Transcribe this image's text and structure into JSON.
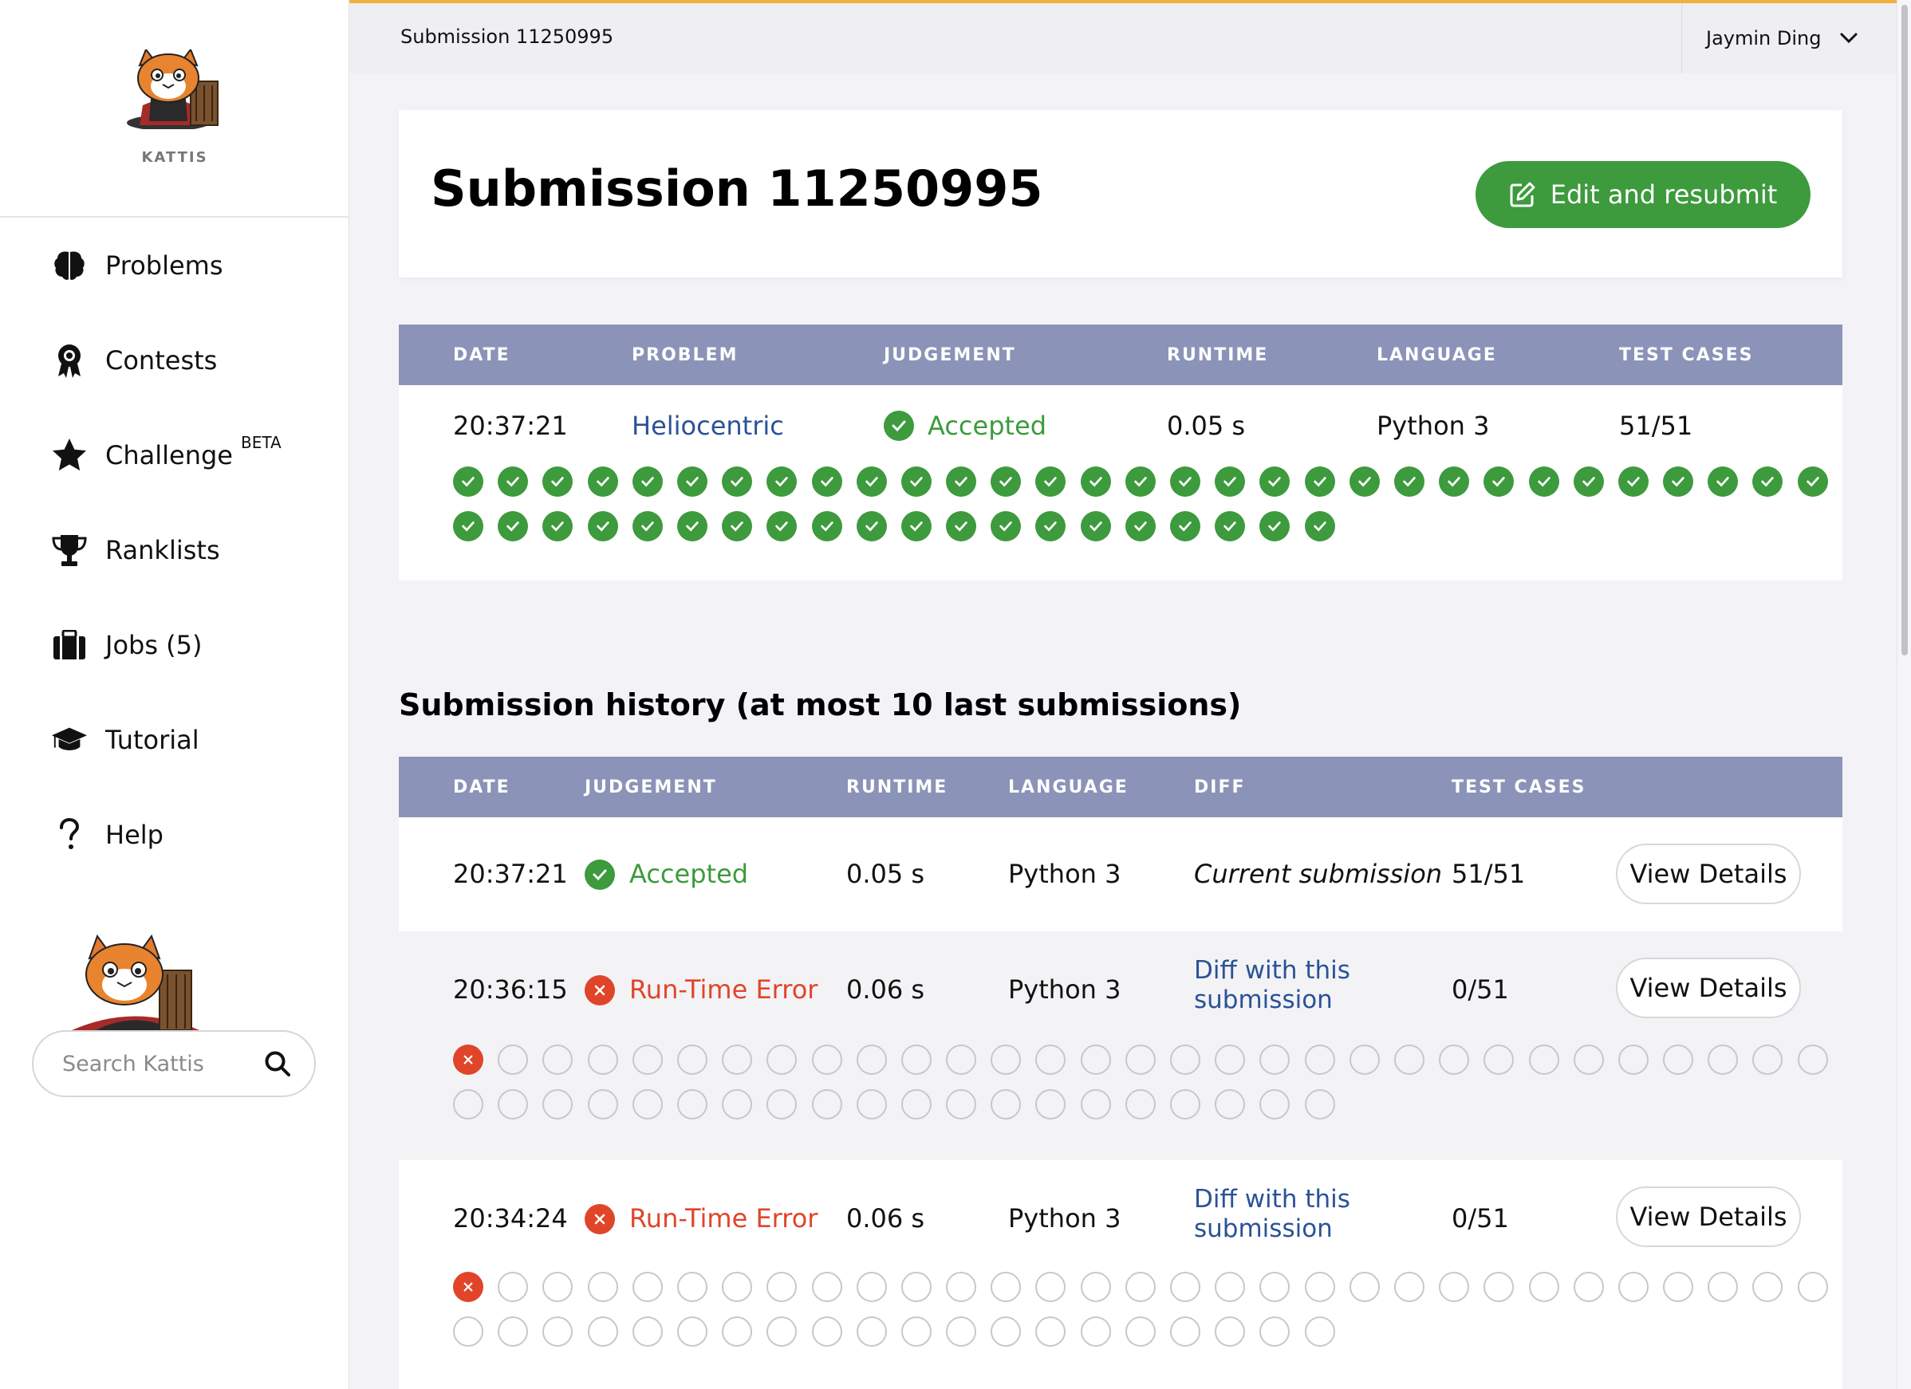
{
  "sidebar": {
    "brand": "KATTIS",
    "nav": [
      {
        "label": "Problems",
        "icon": "brain-icon"
      },
      {
        "label": "Contests",
        "icon": "award-icon"
      },
      {
        "label": "Challenge",
        "icon": "star-icon",
        "badge": "BETA"
      },
      {
        "label": "Ranklists",
        "icon": "trophy-icon"
      },
      {
        "label": "Jobs (5)",
        "icon": "briefcase-icon"
      },
      {
        "label": "Tutorial",
        "icon": "graduation-cap-icon"
      },
      {
        "label": "Help",
        "icon": "question-icon"
      }
    ],
    "search_placeholder": "Search Kattis"
  },
  "topbar": {
    "breadcrumb": "Submission 11250995",
    "user_name": "Jaymin Ding"
  },
  "title_card": {
    "title": "Submission 11250995",
    "resubmit_label": "Edit and resubmit"
  },
  "submission_table": {
    "headers": [
      "DATE",
      "PROBLEM",
      "JUDGEMENT",
      "RUNTIME",
      "LANGUAGE",
      "TEST CASES"
    ],
    "row": {
      "date": "20:37:21",
      "problem": "Heliocentric",
      "judgement": "Accepted",
      "runtime": "0.05 s",
      "language": "Python 3",
      "test_cases": "51/51",
      "tests_passed": 51,
      "tests_total": 51
    }
  },
  "history": {
    "title": "Submission history (at most 10 last submissions)",
    "headers": [
      "DATE",
      "JUDGEMENT",
      "RUNTIME",
      "LANGUAGE",
      "DIFF",
      "TEST CASES"
    ],
    "view_details_label": "View Details",
    "rows": [
      {
        "date": "20:37:21",
        "judgement": "Accepted",
        "status": "accepted",
        "runtime": "0.05 s",
        "language": "Python 3",
        "diff": "Current submission",
        "test_cases": "51/51"
      },
      {
        "date": "20:36:15",
        "judgement": "Run-Time Error",
        "status": "error",
        "runtime": "0.06 s",
        "language": "Python 3",
        "diff_line1": "Diff with this",
        "diff_line2": "submission",
        "test_cases": "0/51",
        "tests_failed_first": 1,
        "tests_total": 51
      },
      {
        "date": "20:34:24",
        "judgement": "Run-Time Error",
        "status": "error",
        "runtime": "0.06 s",
        "language": "Python 3",
        "diff_line1": "Diff with this",
        "diff_line2": "submission",
        "test_cases": "0/51",
        "tests_failed_first": 1,
        "tests_total": 51
      }
    ]
  },
  "colors": {
    "accent_green": "#3d9a3d",
    "error_red": "#e0452a",
    "header_blue": "#8b93b8",
    "link_blue": "#2b5296",
    "top_border": "#f0b13c"
  }
}
